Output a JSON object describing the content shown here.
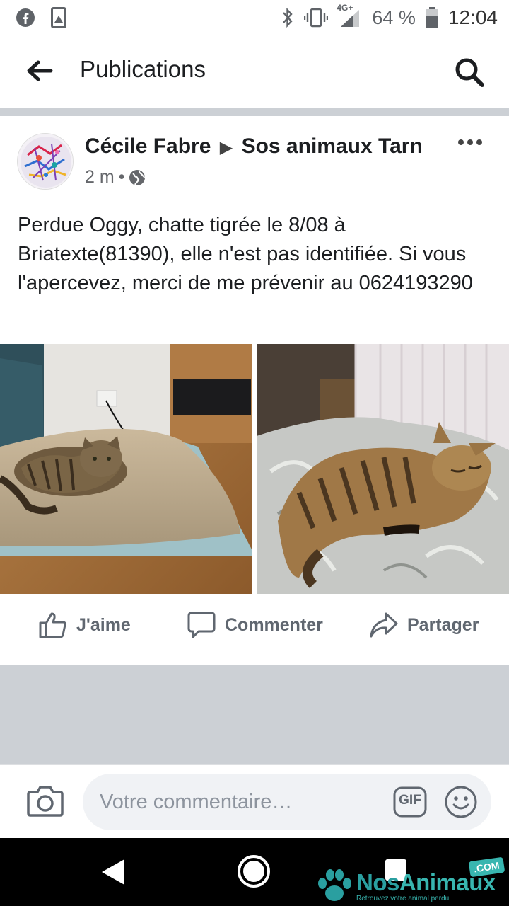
{
  "status_bar": {
    "network": "4G+",
    "battery": "64 %",
    "time": "12:04"
  },
  "header": {
    "title": "Publications",
    "back_icon": "arrow-left-icon",
    "search_icon": "search-icon"
  },
  "post": {
    "author": "Cécile Fabre",
    "group": "Sos animaux Tarn",
    "time": "2 m",
    "audience_icon": "globe-icon",
    "text": "Perdue Oggy, chatte tigrée le 8/08 à Briatexte(81390), elle n'est pas identifiée. Si vous l'apercevez, merci de me prévenir au 0624193290",
    "photos": [
      "photo-cat-on-cushion",
      "photo-cat-on-bed"
    ]
  },
  "actions": {
    "like": "J'aime",
    "comment": "Commenter",
    "share": "Partager"
  },
  "comment_bar": {
    "placeholder": "Votre commentaire…",
    "gif": "GIF"
  },
  "watermark": {
    "brand_a": "Nos",
    "brand_b": "Animaux",
    "tld": ".COM",
    "tagline": "Retrouvez votre animal perdu"
  },
  "colors": {
    "brand_blue": "#1877f2",
    "divider_gray": "#ccd0d5",
    "watermark_teal": "#38b6b0"
  }
}
